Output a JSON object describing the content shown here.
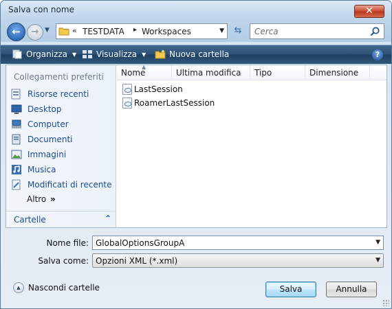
{
  "window": {
    "title": "Salva con nome",
    "close_label": "✕"
  },
  "address": {
    "chevrons": "«",
    "segments": [
      "TESTDATA",
      "Workspaces"
    ],
    "separator": "▸"
  },
  "search": {
    "placeholder": "Cerca"
  },
  "toolbar": {
    "organize": "Organizza",
    "view": "Visualizza",
    "new_folder": "Nuova cartella",
    "help": "?"
  },
  "nav": {
    "header": "Collegamenti preferiti",
    "items": [
      {
        "label": "Risorse recenti",
        "icon": "recent-places-icon"
      },
      {
        "label": "Desktop",
        "icon": "desktop-icon"
      },
      {
        "label": "Computer",
        "icon": "computer-icon"
      },
      {
        "label": "Documenti",
        "icon": "documents-icon"
      },
      {
        "label": "Immagini",
        "icon": "pictures-icon"
      },
      {
        "label": "Musica",
        "icon": "music-icon"
      },
      {
        "label": "Modificati di recente",
        "icon": "recently-changed-icon"
      }
    ],
    "more": "Altro",
    "more_arrows": "»",
    "folders": "Cartelle"
  },
  "files": {
    "columns": [
      "Nome",
      "Ultima modifica",
      "Tipo",
      "Dimensione"
    ],
    "rows": [
      "LastSession",
      "RoamerLastSession"
    ]
  },
  "form": {
    "filename_label": "Nome file:",
    "filename_value": "GlobalOptionsGroupA",
    "savetype_label": "Salva come:",
    "savetype_value": "Opzioni XML (*.xml)"
  },
  "footer": {
    "hide_folders": "Nascondi cartelle",
    "save": "Salva",
    "cancel": "Annulla"
  }
}
